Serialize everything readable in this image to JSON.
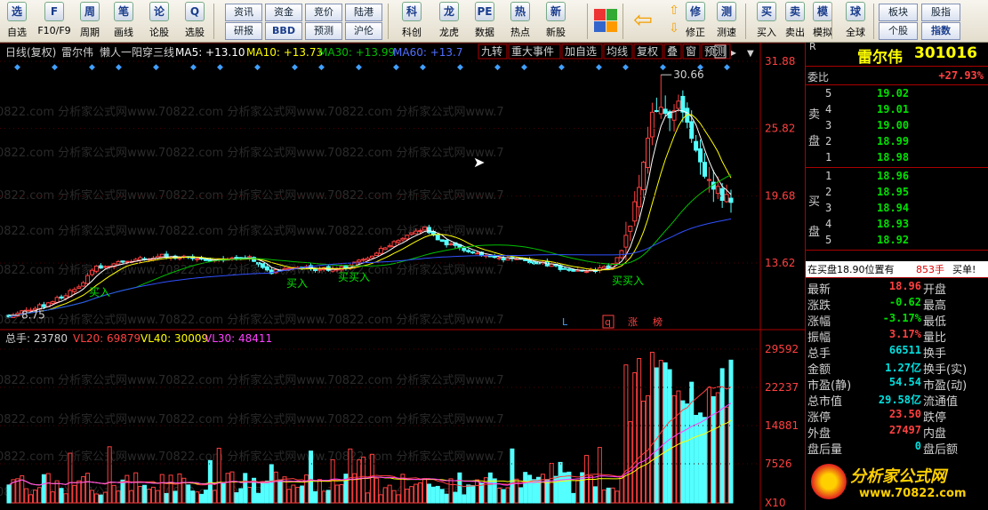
{
  "toolbar": {
    "buttons": [
      {
        "label": "自选",
        "icon": "选"
      },
      {
        "label": "F10/F9",
        "icon": "F"
      },
      {
        "label": "周期",
        "icon": "周"
      },
      {
        "label": "画线",
        "icon": "笔"
      },
      {
        "label": "论股",
        "icon": "论"
      },
      {
        "label": "选股",
        "icon": "Q"
      },
      {
        "label": "科创",
        "icon": "科"
      },
      {
        "label": "龙虎",
        "icon": "龙"
      },
      {
        "label": "数据",
        "icon": "PE"
      },
      {
        "label": "热点",
        "icon": "热"
      },
      {
        "label": "新股",
        "icon": "新"
      },
      {
        "label": "修正",
        "icon": "修"
      },
      {
        "label": "测速",
        "icon": "测"
      },
      {
        "label": "买入",
        "icon": "买"
      },
      {
        "label": "卖出",
        "icon": "卖"
      },
      {
        "label": "模拟",
        "icon": "模"
      },
      {
        "label": "全球",
        "icon": "球"
      }
    ],
    "menu_top": [
      "资讯",
      "资金",
      "竞价",
      "陆港"
    ],
    "menu_bottom": [
      "研报",
      "BBD",
      "预测",
      "沪伦"
    ],
    "right_top": [
      "板块",
      "股指"
    ],
    "right_bottom": [
      "个股",
      "指数"
    ]
  },
  "chart_header": {
    "period": "日线(复权)",
    "stock": "雷尔伟",
    "formula": "懒人一阳穿三线",
    "ma5": "MA5: +13.10",
    "ma10": "MA10: +13.73",
    "ma30": "MA30: +13.99",
    "ma60": "MA60: +13.7",
    "tabs": [
      "九转",
      "重大事件",
      "加自选",
      "均线",
      "复权",
      "叠",
      "窗",
      "预测"
    ]
  },
  "vol_header": {
    "total": "总手: 23780",
    "vl20": "VL20: 69879",
    "vl40": "VL40: 30009",
    "vl30": "VL30: 48411"
  },
  "price_axis": [
    "31.88",
    "25.82",
    "19.68",
    "13.62"
  ],
  "vol_axis": [
    "29592",
    "22237",
    "14881",
    "7526",
    "X10"
  ],
  "annotations": {
    "high": "30.66",
    "low": "8.75",
    "buy_labels": [
      "买入",
      "买入",
      "买买入",
      "买买入"
    ],
    "markers": [
      "L",
      "q",
      "涨",
      "榜"
    ]
  },
  "watermark": "0822.com 分析家公式网www.70822.com 分析家公式网www.70822.com 分析家公式网www.7",
  "logo": {
    "text": "分析家公式网",
    "url": "www.70822.com"
  },
  "quote": {
    "r_mark": "R",
    "name": "雷尔伟",
    "code": "301016",
    "weibi_label": "委比",
    "weibi": "+27.93%",
    "sell_label": [
      "卖",
      "盘"
    ],
    "buy_label": [
      "买",
      "盘"
    ],
    "asks": [
      {
        "lvl": "5",
        "price": "19.02"
      },
      {
        "lvl": "4",
        "price": "19.01"
      },
      {
        "lvl": "3",
        "price": "19.00"
      },
      {
        "lvl": "2",
        "price": "18.99"
      },
      {
        "lvl": "1",
        "price": "18.98"
      }
    ],
    "bids": [
      {
        "lvl": "1",
        "price": "18.96"
      },
      {
        "lvl": "2",
        "price": "18.95"
      },
      {
        "lvl": "3",
        "price": "18.94"
      },
      {
        "lvl": "4",
        "price": "18.93"
      },
      {
        "lvl": "5",
        "price": "18.92"
      }
    ],
    "notice_a": "在买盘18.90位置有",
    "notice_b": "853手",
    "notice_c": "买单!",
    "stats": [
      {
        "l": "最新",
        "v": "18.96",
        "r": "开盘",
        "c": "#ff4040"
      },
      {
        "l": "涨跌",
        "v": "-0.62",
        "r": "最高",
        "c": "#00e000"
      },
      {
        "l": "涨幅",
        "v": "-3.17%",
        "r": "最低",
        "c": "#00e000"
      },
      {
        "l": "振幅",
        "v": "3.17%",
        "r": "量比",
        "c": "#ff4040"
      },
      {
        "l": "总手",
        "v": "66511",
        "r": "换手",
        "c": "#00e0e0"
      },
      {
        "l": "金额",
        "v": "1.27亿",
        "r": "换手(实)",
        "c": "#00e0e0"
      },
      {
        "l": "市盈(静)",
        "v": "54.54",
        "r": "市盈(动)",
        "c": "#00e0e0"
      },
      {
        "l": "总市值",
        "v": "29.58亿",
        "r": "流通值",
        "c": "#00e0e0"
      },
      {
        "l": "涨停",
        "v": "23.50",
        "r": "跌停",
        "c": "#ff4040"
      },
      {
        "l": "外盘",
        "v": "27497",
        "r": "内盘",
        "c": "#ff4040"
      },
      {
        "l": "盘后量",
        "v": "0",
        "r": "盘后额",
        "c": "#00e0e0"
      }
    ]
  },
  "colors": {
    "up": "#ff4040",
    "down": "#54ffff",
    "ma5": "#ffffff",
    "ma10": "#ffff00",
    "ma30": "#00c000",
    "ma60": "#3050ff",
    "grid": "#a00000"
  }
}
